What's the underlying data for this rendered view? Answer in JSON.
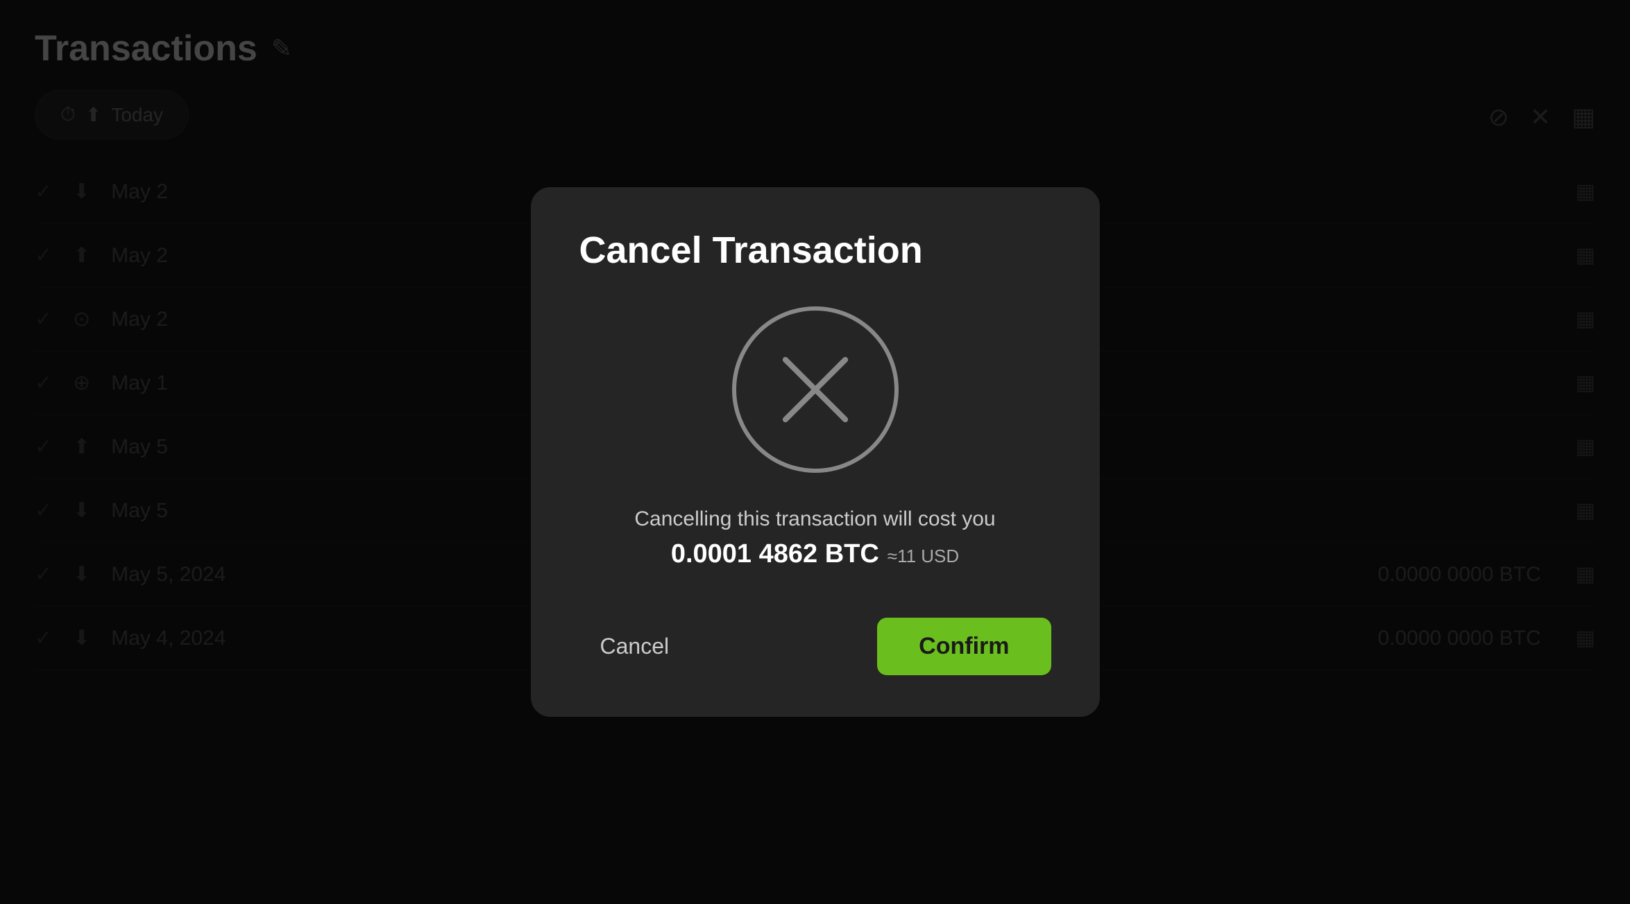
{
  "background": {
    "title": "Transactions",
    "edit_icon": "✎",
    "filter": {
      "clock_icon": "🕐",
      "upload_icon": "⬆",
      "label": "Today"
    },
    "rows": [
      {
        "date": "May 2",
        "icon": "⬇"
      },
      {
        "date": "May 2",
        "icon": "⬆"
      },
      {
        "date": "May 2",
        "icon": "⊙"
      },
      {
        "date": "May 1",
        "icon": "⊕"
      },
      {
        "date": "May 5",
        "icon": "⬆"
      },
      {
        "date": "May 5",
        "icon": "⬇"
      },
      {
        "date": "May 5, 2024",
        "amount": "0.0000 0000 BTC"
      },
      {
        "date": "May 4, 2024",
        "amount": "0.0000 0000 BTC"
      }
    ]
  },
  "modal": {
    "title": "Cancel Transaction",
    "description": "Cancelling this transaction will cost you",
    "amount_btc": "0.0001 4862 BTC",
    "amount_usd": "≈11 USD",
    "cancel_label": "Cancel",
    "confirm_label": "Confirm",
    "colors": {
      "confirm_bg": "#6abf1e",
      "confirm_text": "#1a1a1a"
    }
  }
}
